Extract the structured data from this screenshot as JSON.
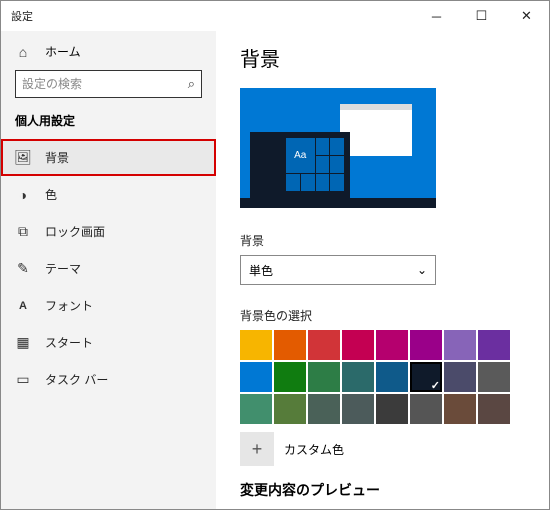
{
  "titlebar": {
    "title": "設定"
  },
  "sidebar": {
    "home_label": "ホーム",
    "search_placeholder": "設定の検索",
    "section_label": "個人用設定",
    "items": [
      {
        "label": "背景"
      },
      {
        "label": "色"
      },
      {
        "label": "ロック画面"
      },
      {
        "label": "テーマ"
      },
      {
        "label": "フォント"
      },
      {
        "label": "スタート"
      },
      {
        "label": "タスク バー"
      }
    ]
  },
  "main": {
    "heading": "背景",
    "preview_sample": "Aa",
    "bg_label": "背景",
    "bg_dropdown_value": "単色",
    "swatch_label": "背景色の選択",
    "custom_label": "カスタム色",
    "bottom_heading": "変更内容のプレビュー"
  },
  "colors": {
    "row1": [
      "#f7b500",
      "#e35b00",
      "#d13438",
      "#c40052",
      "#b5006e",
      "#9a0089",
      "#8764b8",
      "#6b2fa0"
    ],
    "row2": [
      "#0078d4",
      "#107c10",
      "#2d7d46",
      "#2b6a6a",
      "#0f5a8a",
      "#0f1a2a",
      "#4b4b6a",
      "#5a5a5a"
    ],
    "row3": [
      "#418f6d",
      "#567c3a",
      "#4a6158",
      "#4c5b5b",
      "#3b3b3b",
      "#555555",
      "#6a4b3a",
      "#5a4742"
    ]
  },
  "selected_color_index": 13
}
